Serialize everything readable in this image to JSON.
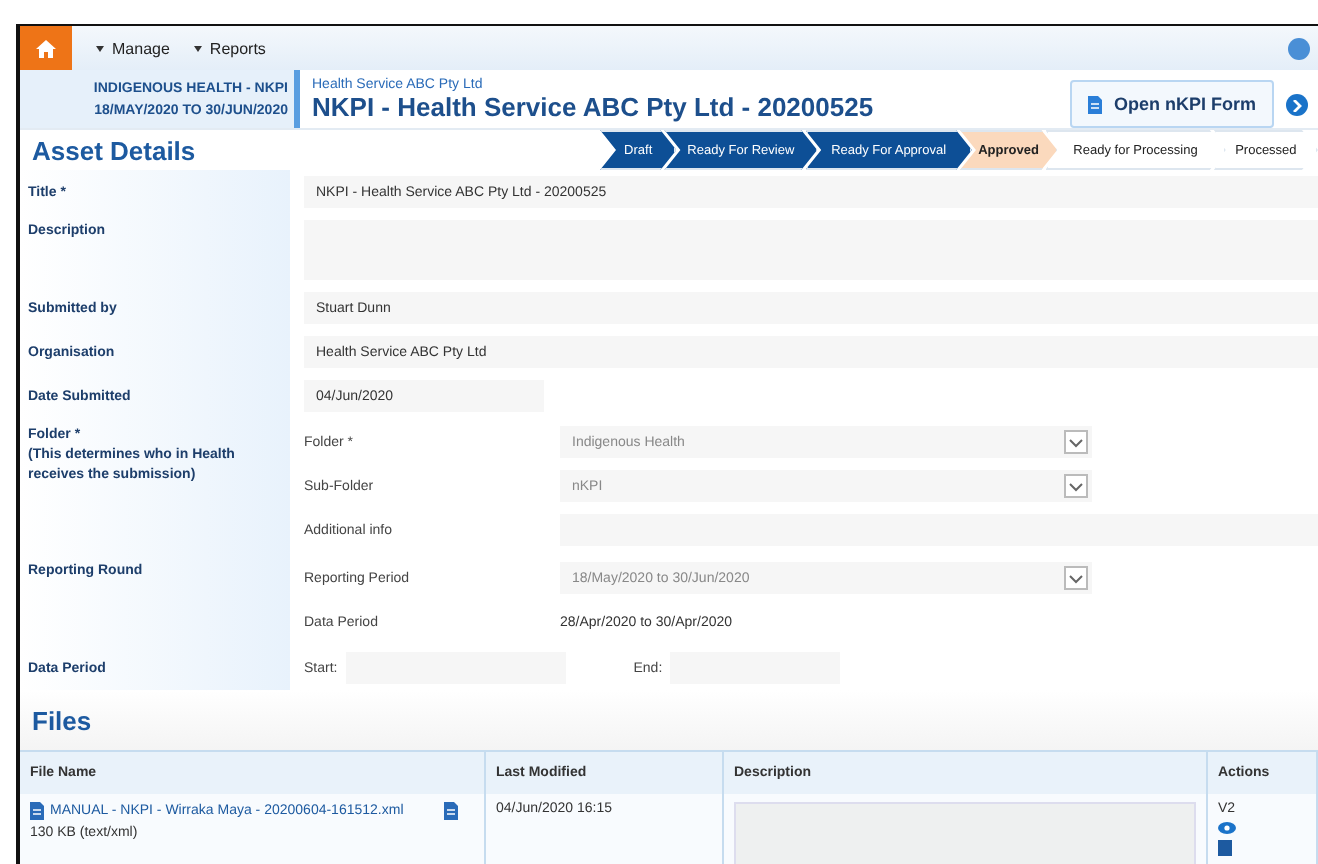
{
  "nav": {
    "items": [
      {
        "label": "Manage"
      },
      {
        "label": "Reports"
      }
    ]
  },
  "header": {
    "context_line1": "INDIGENOUS HEALTH - NKPI",
    "context_line2": "18/MAY/2020 TO 30/JUN/2020",
    "organisation": "Health Service ABC Pty Ltd",
    "title": "NKPI - Health Service ABC Pty Ltd - 20200525",
    "open_button": "Open nKPI Form"
  },
  "asset_details": {
    "heading": "Asset Details",
    "workflow": [
      {
        "label": "Draft",
        "completed": true,
        "selected": false
      },
      {
        "label": "Ready For Review",
        "completed": true,
        "selected": false
      },
      {
        "label": "Ready For Approval",
        "completed": true,
        "selected": false
      },
      {
        "label": "Approved",
        "completed": false,
        "selected": true
      },
      {
        "label": "Ready for Processing",
        "completed": false,
        "selected": false
      },
      {
        "label": "Processed",
        "completed": false,
        "selected": false
      }
    ],
    "rows": [
      {
        "kind": "field",
        "label": "Title *",
        "value": "NKPI - Health Service ABC Pty Ltd - 20200525"
      },
      {
        "kind": "area",
        "label": "Description"
      },
      {
        "kind": "field",
        "label": "Submitted by",
        "value": "Stuart Dunn"
      },
      {
        "kind": "field",
        "label": "Organisation",
        "value": "Health Service ABC Pty Ltd"
      },
      {
        "kind": "short",
        "label": "Date Submitted",
        "value": "04/Jun/2020"
      },
      {
        "kind": "group",
        "label": "Folder *",
        "note": "(This determines who in Health receives the submission)",
        "subs": [
          {
            "kind": "select",
            "label": "Folder *",
            "value": "Indigenous Health",
            "disabled": true
          },
          {
            "kind": "select",
            "label": "Sub-Folder",
            "value": "nKPI",
            "disabled": true
          },
          {
            "kind": "input",
            "label": "Additional info"
          }
        ]
      },
      {
        "kind": "group",
        "label": "Reporting Round",
        "subs": [
          {
            "kind": "select",
            "label": "Reporting Period",
            "value": "18/May/2020 to 30/Jun/2020",
            "disabled": true
          },
          {
            "kind": "text",
            "label": "Data Period",
            "value": "28/Apr/2020 to 30/Apr/2020"
          }
        ]
      },
      {
        "kind": "range",
        "label": "Data Period",
        "start_label": "Start:",
        "end_label": "End:"
      }
    ]
  },
  "files": {
    "heading": "Files",
    "columns": [
      "File Name",
      "Last Modified",
      "Description",
      "Actions"
    ],
    "rows": [
      {
        "name": "MANUAL - NKPI - Wirraka Maya - 20200604-161512.xml",
        "size": "130 KB (text/xml)",
        "modified": "04/Jun/2020 16:15",
        "version": "V2"
      }
    ]
  }
}
